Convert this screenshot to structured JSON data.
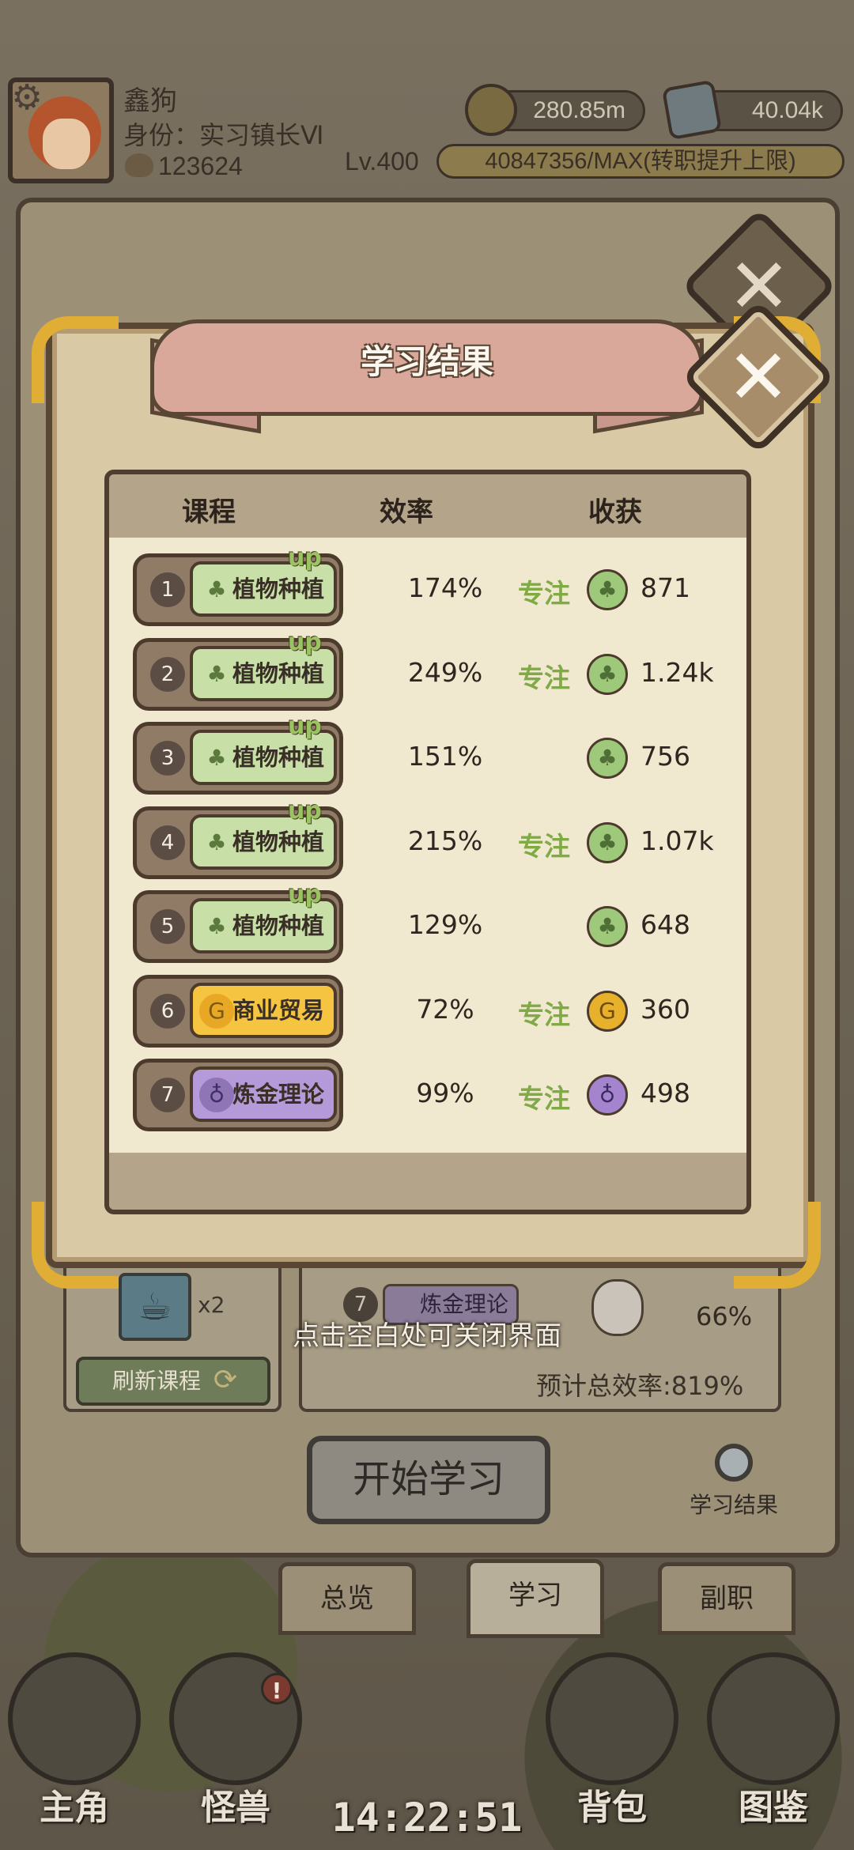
{
  "hud": {
    "name": "鑫狗",
    "role": "身份：实习镇长Ⅵ",
    "coins": "123624",
    "gold": "280.85m",
    "ore": "40.04k",
    "level": "Lv.400",
    "xp": "40847356/MAX(转职提升上限)"
  },
  "modal": {
    "title": "学习结果",
    "headers": {
      "course": "课程",
      "efficiency": "效率",
      "gain": "收获"
    },
    "up_label": "up",
    "focus_label": "专注",
    "rows": [
      {
        "rank": "1",
        "course": "植物种植",
        "efficiency": "174%",
        "focus": true,
        "gain": "871",
        "type": "plant",
        "up": true
      },
      {
        "rank": "2",
        "course": "植物种植",
        "efficiency": "249%",
        "focus": true,
        "gain": "1.24k",
        "type": "plant",
        "up": true
      },
      {
        "rank": "3",
        "course": "植物种植",
        "efficiency": "151%",
        "focus": false,
        "gain": "756",
        "type": "plant",
        "up": true
      },
      {
        "rank": "4",
        "course": "植物种植",
        "efficiency": "215%",
        "focus": true,
        "gain": "1.07k",
        "type": "plant",
        "up": true
      },
      {
        "rank": "5",
        "course": "植物种植",
        "efficiency": "129%",
        "focus": false,
        "gain": "648",
        "type": "plant",
        "up": true
      },
      {
        "rank": "6",
        "course": "商业贸易",
        "efficiency": "72%",
        "focus": true,
        "gain": "360",
        "type": "trade",
        "up": false
      },
      {
        "rank": "7",
        "course": "炼金理论",
        "efficiency": "99%",
        "focus": true,
        "gain": "498",
        "type": "alchemy",
        "up": false
      }
    ]
  },
  "back": {
    "multiplier": "x2",
    "refresh_label": "刷新课程",
    "row_rank": "7",
    "row_course": "炼金理论",
    "row_pct": "66%",
    "close_hint": "点击空白处可关闭界面",
    "total_efficiency": "预计总效率:819%",
    "start_label": "开始学习",
    "result_link": "学习结果"
  },
  "tabs": [
    "总览",
    "学习",
    "副职"
  ],
  "nav": [
    "主角",
    "怪兽",
    "背包",
    "图鉴"
  ],
  "badge": "!",
  "clock": "14:22:51",
  "colors": {
    "plant": "#c8e0a8",
    "trade": "#f5c440",
    "alchemy": "#b59ad9",
    "focus": "#7faa46",
    "corner_gold": "#e0ad35"
  }
}
